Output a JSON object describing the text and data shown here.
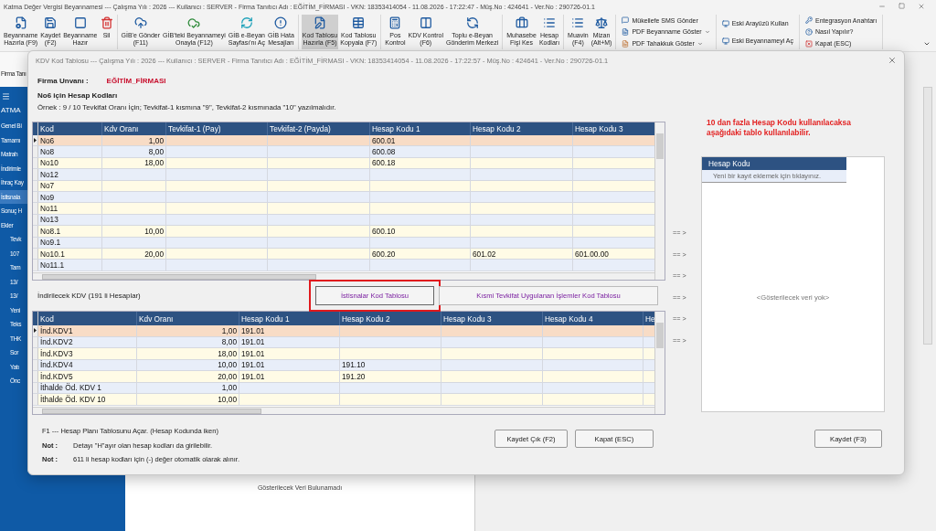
{
  "app_window": {
    "title": "Katma Değer Vergisi Beyannamesi --- Çalışma Yılı : 2026 --- Kullanıcı : SERVER - Firma Tanıtıcı Adı : EĞİTİM_FİRMASI - VKN: 18353414054 - 11.08.2026 - 17:22:47 - Müş.No : 424641 - Ver.No : 290726-01.1"
  },
  "ribbon": {
    "groups": [
      {
        "kind": "large",
        "items": [
          {
            "lines": [
              "Beyanname",
              "Hazırla (F9)"
            ],
            "selected": false
          },
          {
            "lines": [
              "Kaydet",
              "(F2)"
            ],
            "selected": false
          },
          {
            "lines": [
              "Beyanname",
              "Hazır"
            ],
            "selected": false
          },
          {
            "lines": [
              "Sil"
            ],
            "selected": false
          }
        ]
      },
      {
        "kind": "large",
        "items": [
          {
            "lines": [
              "GİB'e Gönder",
              "(F11)"
            ],
            "selected": false
          },
          {
            "lines": [
              "GİB'teki Beyannameyi",
              "Onayla (F12)"
            ],
            "selected": false
          },
          {
            "lines": [
              "GİB e-Beyan",
              "Sayfası'nı Aç"
            ],
            "selected": false
          },
          {
            "lines": [
              "GİB Hata",
              "Mesajları"
            ],
            "selected": false
          }
        ]
      },
      {
        "kind": "large",
        "items": [
          {
            "lines": [
              "Kod Tablosu",
              "Hazırla (F5)"
            ],
            "selected": true
          },
          {
            "lines": [
              "Kod Tablosu",
              "Kopyala (F7)"
            ],
            "selected": false
          }
        ]
      },
      {
        "kind": "large",
        "items": [
          {
            "lines": [
              "Pos",
              "Kontrol"
            ],
            "selected": false
          },
          {
            "lines": [
              "KDV Kontrol",
              "(F6)"
            ],
            "selected": false
          },
          {
            "lines": [
              "Toplu e-Beyan",
              "Gönderim Merkezi"
            ],
            "selected": false
          }
        ]
      },
      {
        "kind": "large",
        "items": [
          {
            "lines": [
              "Muhasebe",
              "Fişi Kes"
            ],
            "selected": false
          },
          {
            "lines": [
              "Hesap",
              "Kodları"
            ],
            "selected": false
          }
        ]
      },
      {
        "kind": "large",
        "items": [
          {
            "lines": [
              "Muavin",
              "(F4)"
            ],
            "selected": false
          },
          {
            "lines": [
              "Mizan",
              "(Alt+M)"
            ],
            "selected": false
          }
        ]
      },
      {
        "kind": "small",
        "items": [
          {
            "label": "Mükellefe SMS Gönder",
            "dropdown": false
          },
          {
            "label": "PDF Beyanname Göster",
            "dropdown": true
          },
          {
            "label": "PDF Tahakkuk Göster",
            "dropdown": true
          }
        ]
      },
      {
        "kind": "small",
        "items": [
          {
            "label": "Eski Arayüzü Kullan",
            "dropdown": false
          },
          {
            "label": "Eski Beyannameyi Aç",
            "dropdown": false
          }
        ]
      },
      {
        "kind": "small",
        "items": [
          {
            "label": "Entegrasyon Anahtarı",
            "dropdown": false
          },
          {
            "label": "Nasıl Yapılır?",
            "dropdown": false
          },
          {
            "label": "Kapat (ESC)",
            "dropdown": false
          }
        ]
      }
    ]
  },
  "sidebar": {
    "header": "Firma Tanı",
    "title": "ATMA",
    "items": [
      {
        "label": "Genel Bi",
        "selected": false
      },
      {
        "label": "Tamamı",
        "selected": false
      },
      {
        "label": "Matrah",
        "selected": false
      },
      {
        "label": "İndirimle",
        "selected": false
      },
      {
        "label": "İhraç Kay",
        "selected": false
      },
      {
        "label": "İstisnala",
        "selected": true
      },
      {
        "label": "Sonuç H",
        "selected": false
      },
      {
        "label": "Ekler",
        "selected": false,
        "children": [
          {
            "label": "Tevk",
            "selected": false
          },
          {
            "label": "107",
            "selected": false
          },
          {
            "label": "Tam",
            "selected": false
          },
          {
            "label": "13/",
            "selected": false
          },
          {
            "label": "13/",
            "selected": false
          },
          {
            "label": "Yeni",
            "selected": false
          },
          {
            "label": "Teks",
            "selected": false
          },
          {
            "label": "THK",
            "selected": false
          },
          {
            "label": "Sor",
            "selected": false
          },
          {
            "label": "Yatı",
            "selected": false
          },
          {
            "label": "Önc",
            "selected": false
          }
        ]
      }
    ]
  },
  "document": {
    "empty_text": "Gösterilecek Veri Bulunamadı"
  },
  "dialog": {
    "title": "KDV Kod Tablosu --- Çalışma Yılı : 2026 --- Kullanıcı : SERVER - Firma Tanıtıcı Adı : EĞİTİM_FİRMASI - VKN: 18353414054 - 11.08.2026 - 17:22:57 - Müş.No : 424641 - Ver.No : 290726-01.1",
    "firma_label": "Firma Unvanı :",
    "firma_value": "EĞİTİM_FİRMASI",
    "heading": "No6 için Hesap Kodları",
    "example": "Örnek : 9 / 10 Tevkifat Oranı İçin; Tevkifat-1 kısmına \"9\", Tevkifat-2 kısmınada \"10\" yazılmalıdır.",
    "main_table": {
      "columns": [
        "Kod",
        "Kdv Oranı",
        "Tevkifat-1 (Pay)",
        "Tevkifat-2 (Payda)",
        "Hesap Kodu 1",
        "Hesap Kodu 2",
        "Hesap Kodu 3"
      ],
      "rows": [
        {
          "selected": true,
          "cells": [
            "No6",
            "1,00",
            null,
            null,
            "600.01",
            null,
            null
          ]
        },
        {
          "selected": false,
          "cells": [
            "No8",
            "8,00",
            null,
            null,
            "600.08",
            null,
            null
          ]
        },
        {
          "selected": false,
          "cells": [
            "No10",
            "18,00",
            null,
            null,
            "600.18",
            null,
            null
          ]
        },
        {
          "selected": false,
          "cells": [
            "No12",
            null,
            null,
            null,
            null,
            null,
            null
          ]
        },
        {
          "selected": false,
          "cells": [
            "No7",
            null,
            null,
            null,
            null,
            null,
            null
          ]
        },
        {
          "selected": false,
          "cells": [
            "No9",
            null,
            null,
            null,
            null,
            null,
            null
          ]
        },
        {
          "selected": false,
          "cells": [
            "No11",
            null,
            null,
            null,
            null,
            null,
            null
          ]
        },
        {
          "selected": false,
          "cells": [
            "No13",
            null,
            null,
            null,
            null,
            null,
            null
          ]
        },
        {
          "selected": false,
          "cells": [
            "No8.1",
            "10,00",
            null,
            null,
            "600.10",
            null,
            null
          ]
        },
        {
          "selected": false,
          "cells": [
            "No9.1",
            null,
            null,
            null,
            null,
            null,
            null
          ]
        },
        {
          "selected": false,
          "cells": [
            "No10.1",
            "20,00",
            null,
            null,
            "600.20",
            "601.02",
            "601.00.00"
          ]
        },
        {
          "selected": false,
          "cells": [
            "No11.1",
            null,
            null,
            null,
            null,
            null,
            null
          ]
        }
      ]
    },
    "section_label": "İndirilecek KDV (191 li Hesaplar)",
    "section_buttons": [
      {
        "label": "İstisnalar Kod Tablosu",
        "highlighted": true
      },
      {
        "label": "Kısmi Tevkifat Uygulanan İşlemler Kod Tablosu",
        "highlighted": false
      }
    ],
    "kdv_table": {
      "columns": [
        "Kod",
        "Kdv Oranı",
        "Hesap Kodu 1",
        "Hesap Kodu 2",
        "Hesap Kodu 3",
        "Hesap Kodu 4",
        "He"
      ],
      "rows": [
        {
          "selected": true,
          "cells": [
            "İnd.KDV1",
            "1,00",
            "191.01",
            null,
            null,
            null,
            null
          ]
        },
        {
          "selected": false,
          "cells": [
            "İnd.KDV2",
            "8,00",
            "191.01",
            null,
            null,
            null,
            null
          ]
        },
        {
          "selected": false,
          "cells": [
            "İnd.KDV3",
            "18,00",
            "191.01",
            null,
            null,
            null,
            null
          ]
        },
        {
          "selected": false,
          "cells": [
            "İnd.KDV4",
            "10,00",
            "191.01",
            "191.10",
            null,
            null,
            null
          ]
        },
        {
          "selected": false,
          "cells": [
            "İnd.KDV5",
            "20,00",
            "191.01",
            "191.20",
            null,
            null,
            null
          ]
        },
        {
          "selected": false,
          "cells": [
            "İthalde Öd. KDV 1",
            "1,00",
            null,
            null,
            null,
            null,
            null
          ]
        },
        {
          "selected": false,
          "cells": [
            "İthalde Öd. KDV 10",
            "10,00",
            null,
            null,
            null,
            null,
            null
          ]
        }
      ]
    },
    "arrows": [
      "== >",
      "== >",
      "== >",
      "== >",
      "== >",
      "== >"
    ],
    "side_note": "10 dan fazla  Hesap Kodu kullanılacaksa aşağıdaki tablo kullanılabilir.",
    "side_table": {
      "column": "Hesap Kodu",
      "new_row": "Yeni bir kayıt eklemek için tıklayınız.",
      "empty_text": "<Gösterilecek veri yok>"
    },
    "notes": [
      {
        "text": "F1 --- Hesap Planı Tablosunu Açar. (Hesap Kodunda iken)"
      },
      {
        "label": "Not :",
        "text": "Detayı \"H\"ayır olan hesap kodları da girilebilir."
      },
      {
        "label": "Not :",
        "text": "611 li hesap kodları için (-) değer otomatik olarak alınır."
      }
    ],
    "buttons": [
      {
        "label": "Kaydet Çık (F2)"
      },
      {
        "label": "Kapat (ESC)"
      },
      {
        "label": "Kaydet (F3)"
      }
    ]
  }
}
